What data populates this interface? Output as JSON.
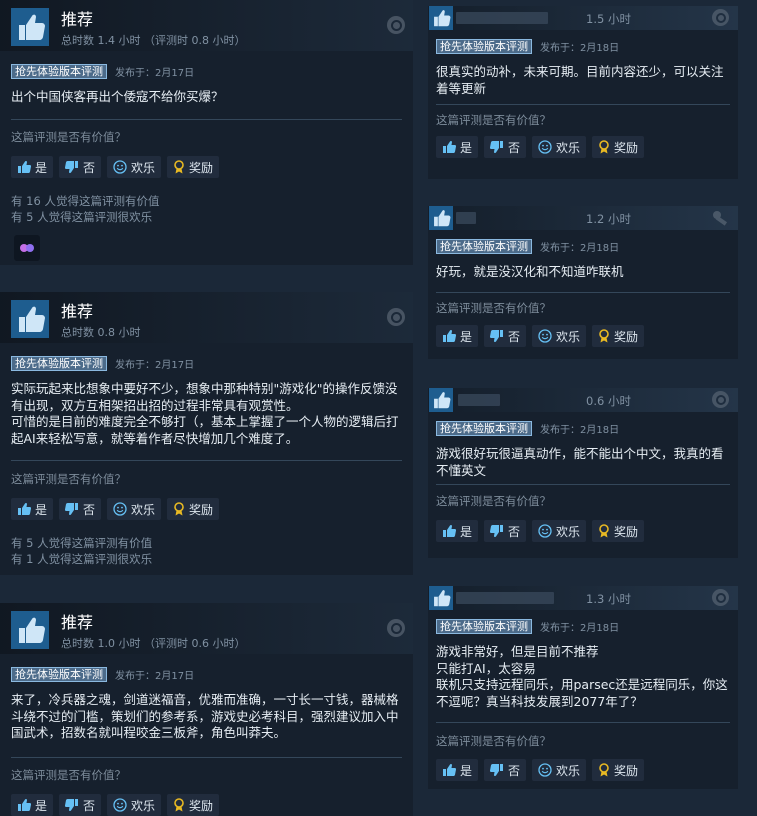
{
  "labels": {
    "recommended": "推荐",
    "early_access": "抢先体验版本评测",
    "helpful_question": "这篇评测是否有价值？",
    "yes": "是",
    "no": "否",
    "funny": "欢乐",
    "award": "奖励"
  },
  "left_reviews": [
    {
      "hours": "总时数 1.4 小时 （评测时 0.8 小时）",
      "posted": "发布于：2月17日",
      "text": "出个中国侠客再出个倭寇不给你买爆？",
      "stat_helpful": "有 16 人觉得这篇评测有价值",
      "stat_funny": "有 5 人觉得这篇评测很欢乐"
    },
    {
      "hours": "总时数 0.8 小时",
      "posted": "发布于：2月17日",
      "text": "实际玩起来比想象中要好不少，想象中那种特别\"游戏化\"的操作反馈没有出现，双方互相架招出招的过程非常具有观赏性。\n可惜的是目前的难度完全不够打（，基本上掌握了一个人物的逻辑后打起AI来轻松写意，就等着作者尽快增加几个难度了。",
      "stat_helpful": "有 5 人觉得这篇评测有价值",
      "stat_funny": "有 1 人觉得这篇评测很欢乐"
    },
    {
      "hours": "总时数 1.0 小时 （评测时 0.6 小时）",
      "posted": "发布于：2月17日",
      "text": "来了，冷兵器之魂，剑道迷福音，优雅而准确，一寸长一寸钱，器械格斗绕不过的门槛，策划们的参考系，游戏史必考科目，强烈建议加入中国武术，招数名就叫程咬金三板斧，角色叫莽夫。"
    }
  ],
  "right_reviews": [
    {
      "hours": "1.5 小时",
      "posted": "发布于：2月18日",
      "text": "很真实的动补，未来可期。目前内容还少，可以关注着等更新",
      "corner": "steam-icon"
    },
    {
      "hours": "1.2 小时",
      "posted": "发布于：2月18日",
      "text": "好玩，就是没汉化和不知道咋联机",
      "corner": "wrench-icon"
    },
    {
      "hours": "0.6 小时",
      "posted": "发布于：2月18日",
      "text": "游戏很好玩很逼真动作，能不能出个中文，我真的看不懂英文",
      "corner": "steam-icon"
    },
    {
      "hours": "1.3 小时",
      "posted": "发布于：2月18日",
      "text": "游戏非常好，但是目前不推荐\n只能打AI，太容易\n联机只支持远程同乐，用parsec还是远程同乐，你这不逗呢？真当科技发展到2077年了？",
      "corner": "steam-icon"
    }
  ],
  "colors": {
    "background": "#1b2838",
    "card": "#16202d",
    "badge_bg": "#4c6b8a",
    "link_blue": "#66c0f4",
    "award_gold": "#e8b923"
  }
}
